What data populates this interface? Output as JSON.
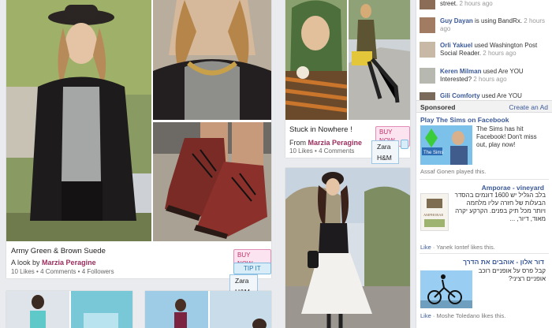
{
  "feed": {
    "card1": {
      "title": "Army Green & Brown Suede",
      "by_prefix": "A look by",
      "author": "Marzia Peragine",
      "likes": "10 Likes",
      "comments": "4 Comments",
      "followers": "4 Followers",
      "buy_label": "BUY NOW",
      "tip_label": "TIP IT",
      "menu": [
        "Zara",
        "H&M"
      ]
    },
    "card2": {
      "title": "Stuck in Nowhere !",
      "from_prefix": "From",
      "author": "Marzia Peragine",
      "likes": "10 Likes",
      "comments": "4 Comments",
      "buy_label": "BUY NOW",
      "menu": [
        "Zara",
        "H&M"
      ]
    }
  },
  "sidebar": {
    "ticker": [
      {
        "name": "",
        "text": "street.",
        "time": "2 hours ago"
      },
      {
        "name": "Guy Dayan",
        "text": "is using BandRx.",
        "time": "2 hours ago"
      },
      {
        "name": "Orli Yakuel",
        "text": "used Washington Post Social Reader.",
        "time": "2 hours ago"
      },
      {
        "name": "Keren Milman",
        "text": "used Are YOU Interested?",
        "time": "2 hours ago"
      },
      {
        "name": "Gili Comforty",
        "text": "used Are YOU",
        "time": ""
      }
    ],
    "sponsored_label": "Sponsored",
    "create_ad_label": "Create an Ad",
    "ads": [
      {
        "title": "Play The Sims on Facebook",
        "text": "The Sims has hit Facebook! Don't miss out, play now!",
        "footer": "Assaf Gonen played this.",
        "image_text": "The Sims Social"
      },
      {
        "title": "Amporae - vineyard",
        "text": "בלב הגליל יש 1600 דונמים בהסדר הבעלות של חזרה עליו מלחמה ויותר מכל תיק בפנים. הקרקע יקרה מאוד, דיור, ...",
        "like_label": "Like",
        "footer": "Yanek Iontef likes this.",
        "image_text": "AMPHORAE"
      },
      {
        "title": "דור אלון - אוהבים את הדרך",
        "text": "קבל פרס על אופניים רוכב אופניים רציני?",
        "like_label": "Like",
        "footer": "Moshe Toledano likes this."
      }
    ]
  },
  "colors": {
    "author": "#9b2d5d",
    "fb_blue": "#3b5998",
    "buy": "#c2306a",
    "tip": "#2a79ae"
  }
}
